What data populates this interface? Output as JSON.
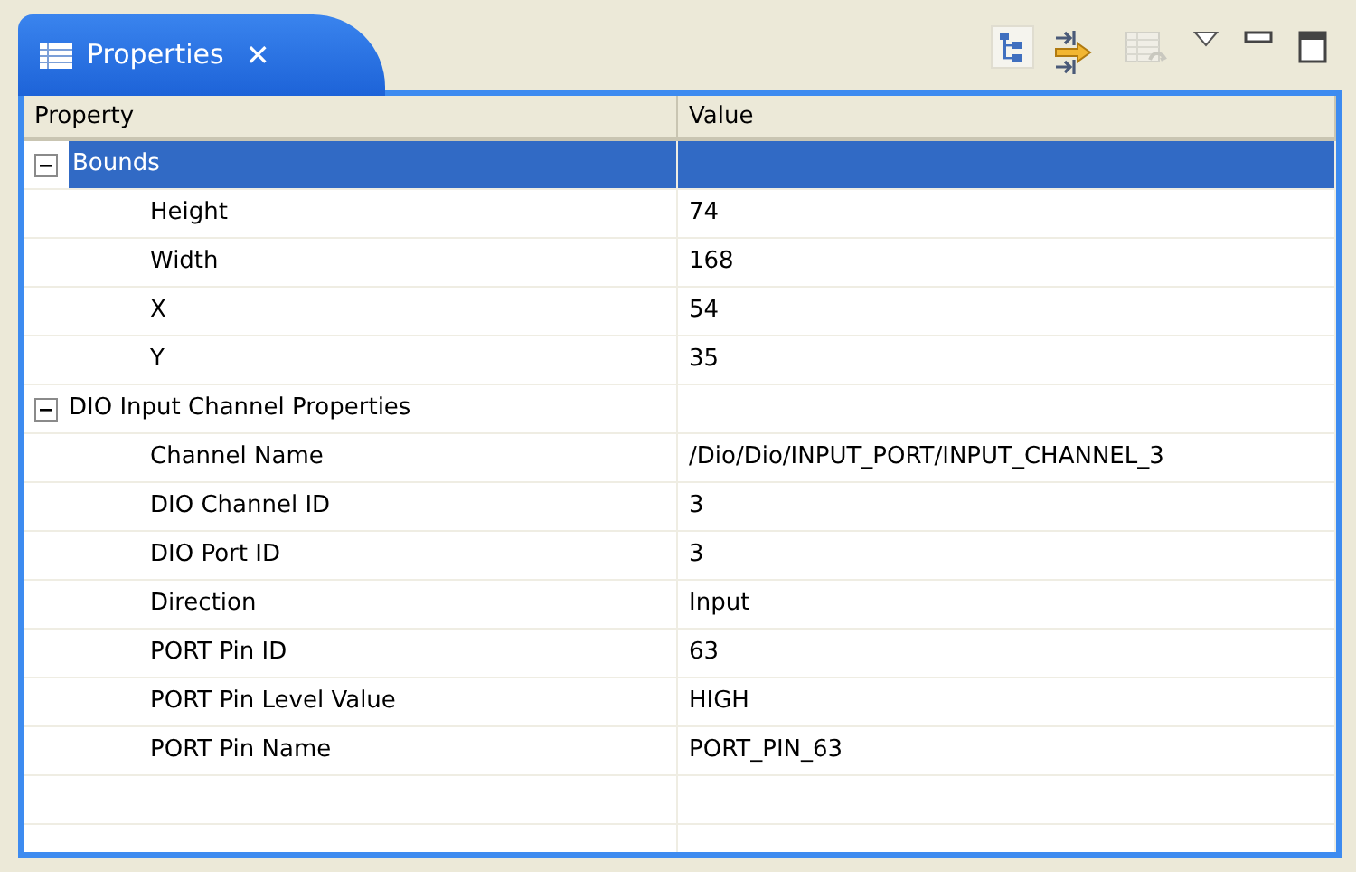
{
  "view_tab": {
    "title": "Properties",
    "close": "✕"
  },
  "toolbar": [
    {
      "kind": "tree",
      "pressed": true
    },
    {
      "kind": "filter",
      "pressed": false
    },
    {
      "kind": "restore",
      "pressed": false,
      "disabled": true
    },
    {
      "kind": "menu"
    },
    {
      "kind": "minimize"
    },
    {
      "kind": "maximize"
    }
  ],
  "table": {
    "columns": [
      "Property",
      "Value"
    ],
    "groups": [
      {
        "name": "Bounds",
        "expanded": true,
        "selected": true,
        "children": [
          {
            "name": "Height",
            "value": "74"
          },
          {
            "name": "Width",
            "value": "168"
          },
          {
            "name": "X",
            "value": "54"
          },
          {
            "name": "Y",
            "value": "35"
          }
        ]
      },
      {
        "name": "DIO Input Channel Properties",
        "expanded": true,
        "selected": false,
        "children": [
          {
            "name": "Channel Name",
            "value": "/Dio/Dio/INPUT_PORT/INPUT_CHANNEL_3"
          },
          {
            "name": "DIO Channel ID",
            "value": "3"
          },
          {
            "name": "DIO Port ID",
            "value": "3"
          },
          {
            "name": "Direction",
            "value": "Input"
          },
          {
            "name": "PORT Pin ID",
            "value": "63"
          },
          {
            "name": "PORT Pin Level Value",
            "value": "HIGH"
          },
          {
            "name": "PORT Pin Name",
            "value": "PORT_PIN_63"
          }
        ]
      }
    ]
  }
}
